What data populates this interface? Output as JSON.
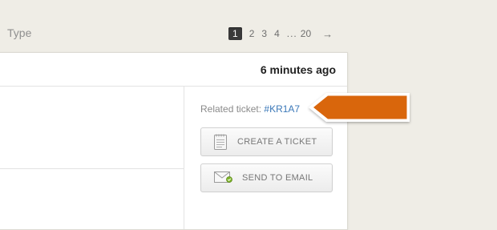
{
  "filter": {
    "type_label": "Type"
  },
  "pagination": {
    "current": "1",
    "pages": [
      "2",
      "3",
      "4"
    ],
    "ellipsis": "...",
    "last": "20",
    "next": "→"
  },
  "item": {
    "timestamp": "6 minutes ago",
    "related_label": "Related ticket:",
    "related_ticket": "#KR1A7",
    "create_ticket_label": "CREATE A TICKET",
    "send_email_label": "SEND TO EMAIL"
  },
  "icons": {
    "create_ticket": "notepad-icon",
    "send_email": "envelope-icon",
    "callout": "orange-arrow-callout"
  },
  "colors": {
    "background": "#efede6",
    "link": "#3b78b8",
    "callout": "#d9660c",
    "page_current_bg": "#3a3a3a"
  }
}
